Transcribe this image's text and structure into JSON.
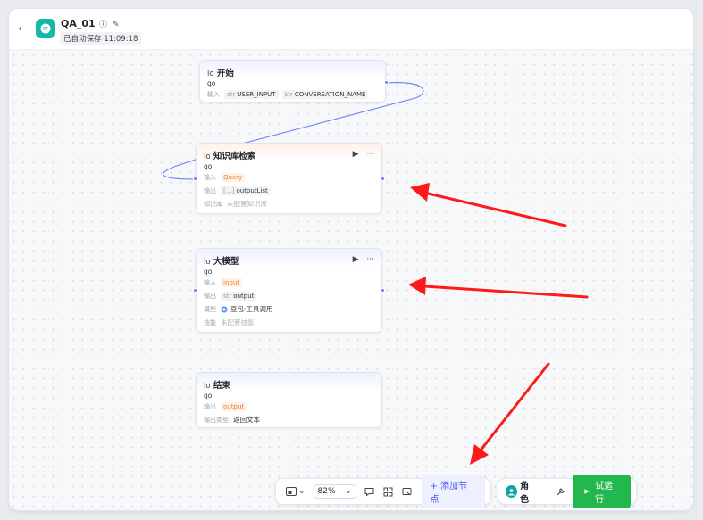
{
  "header": {
    "back_glyph": "‹",
    "title": "QA_01",
    "info_glyph": "ⓘ",
    "edit_glyph": "✎",
    "autosave": "已自动保存 11:09:18"
  },
  "nodes": {
    "start": {
      "img_alt": "lo",
      "title": "开始",
      "sub": "qo",
      "input_label": "输入",
      "inputs": [
        {
          "type": "str",
          "name": "USER_INPUT"
        },
        {
          "type": "str",
          "name": "CONVERSATION_NAME"
        }
      ]
    },
    "kb": {
      "img_alt": "lo",
      "title": "知识库检索",
      "sub": "qo",
      "input_label": "输入",
      "input_value": "Query",
      "output_label": "输出",
      "output_type": "[…]",
      "output_value": "outputList",
      "kb_label": "知识库",
      "kb_value": "未配置知识库",
      "play_glyph": "▶",
      "more_glyph": "···"
    },
    "llm": {
      "img_alt": "lo",
      "title": "大模型",
      "sub": "qo",
      "input_label": "输入",
      "input_value": "input",
      "output_label": "输出",
      "output_type": "str",
      "output_value": "output",
      "model_label": "模型",
      "model_value": "豆包·工具调用",
      "skill_label": "技能",
      "skill_value": "未配置技能",
      "play_glyph": "▶",
      "more_glyph": "···"
    },
    "end": {
      "img_alt": "lo",
      "title": "结束",
      "sub": "qo",
      "output_label": "输出",
      "output_value": "output",
      "output_type_label": "输出类型",
      "output_type_value": "返回文本"
    }
  },
  "toolbar": {
    "zoom": "82%",
    "add_node": "+ 添加节点",
    "role": "角色",
    "run": "试运行",
    "chevron": "⌄"
  },
  "colors": {
    "accent": "#4e5bf2",
    "run_green": "#22b84e",
    "app_teal": "#14b8a6",
    "annotation_red": "#ff1a1a",
    "wire": "#6b7cff"
  }
}
